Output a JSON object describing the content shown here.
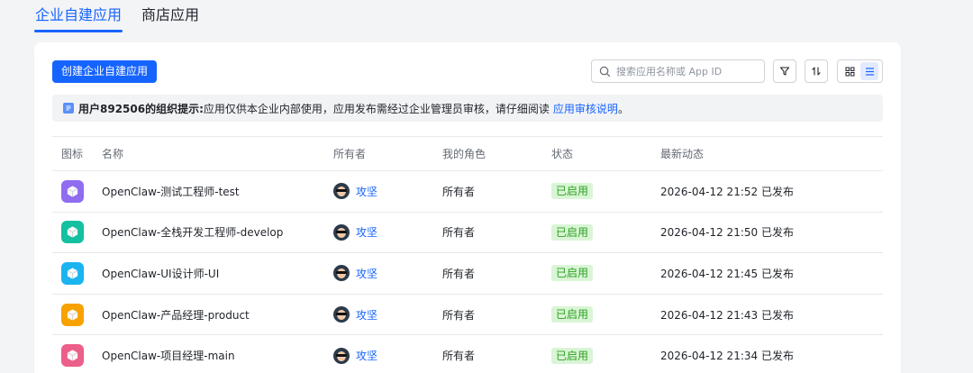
{
  "tabs": [
    {
      "label": "企业自建应用",
      "active": true
    },
    {
      "label": "商店应用",
      "active": false
    }
  ],
  "toolbar": {
    "create_label": "创建企业自建应用",
    "search_placeholder": "搜索应用名称或 App ID"
  },
  "notice": {
    "bold": "用户892506的组织提示:",
    "text": " 应用仅供本企业内部使用，应用发布需经过企业管理员审核，请仔细阅读",
    "link": "应用审核说明",
    "tail": "。"
  },
  "table": {
    "headers": [
      "图标",
      "名称",
      "所有者",
      "我的角色",
      "状态",
      "最新动态"
    ],
    "rows": [
      {
        "name": "OpenClaw-测试工程师-test",
        "owner": "攻坚",
        "role": "所有者",
        "status": "已启用",
        "activity": "2026-04-12 21:52 已发布",
        "color": "#8f6cf0"
      },
      {
        "name": "OpenClaw-全栈开发工程师-develop",
        "owner": "攻坚",
        "role": "所有者",
        "status": "已启用",
        "activity": "2026-04-12 21:50 已发布",
        "color": "#14c0a0"
      },
      {
        "name": "OpenClaw-UI设计师-UI",
        "owner": "攻坚",
        "role": "所有者",
        "status": "已启用",
        "activity": "2026-04-12 21:45 已发布",
        "color": "#1ab4f0"
      },
      {
        "name": "OpenClaw-产品经理-product",
        "owner": "攻坚",
        "role": "所有者",
        "status": "已启用",
        "activity": "2026-04-12 21:43 已发布",
        "color": "#f7a200"
      },
      {
        "name": "OpenClaw-项目经理-main",
        "owner": "攻坚",
        "role": "所有者",
        "status": "已启用",
        "activity": "2026-04-12 21:34 已发布",
        "color": "#ec5f8a"
      }
    ]
  },
  "colors": {
    "primary": "#1664ff",
    "status_bg": "#d9f5d6",
    "status_text": "#2ea121"
  }
}
